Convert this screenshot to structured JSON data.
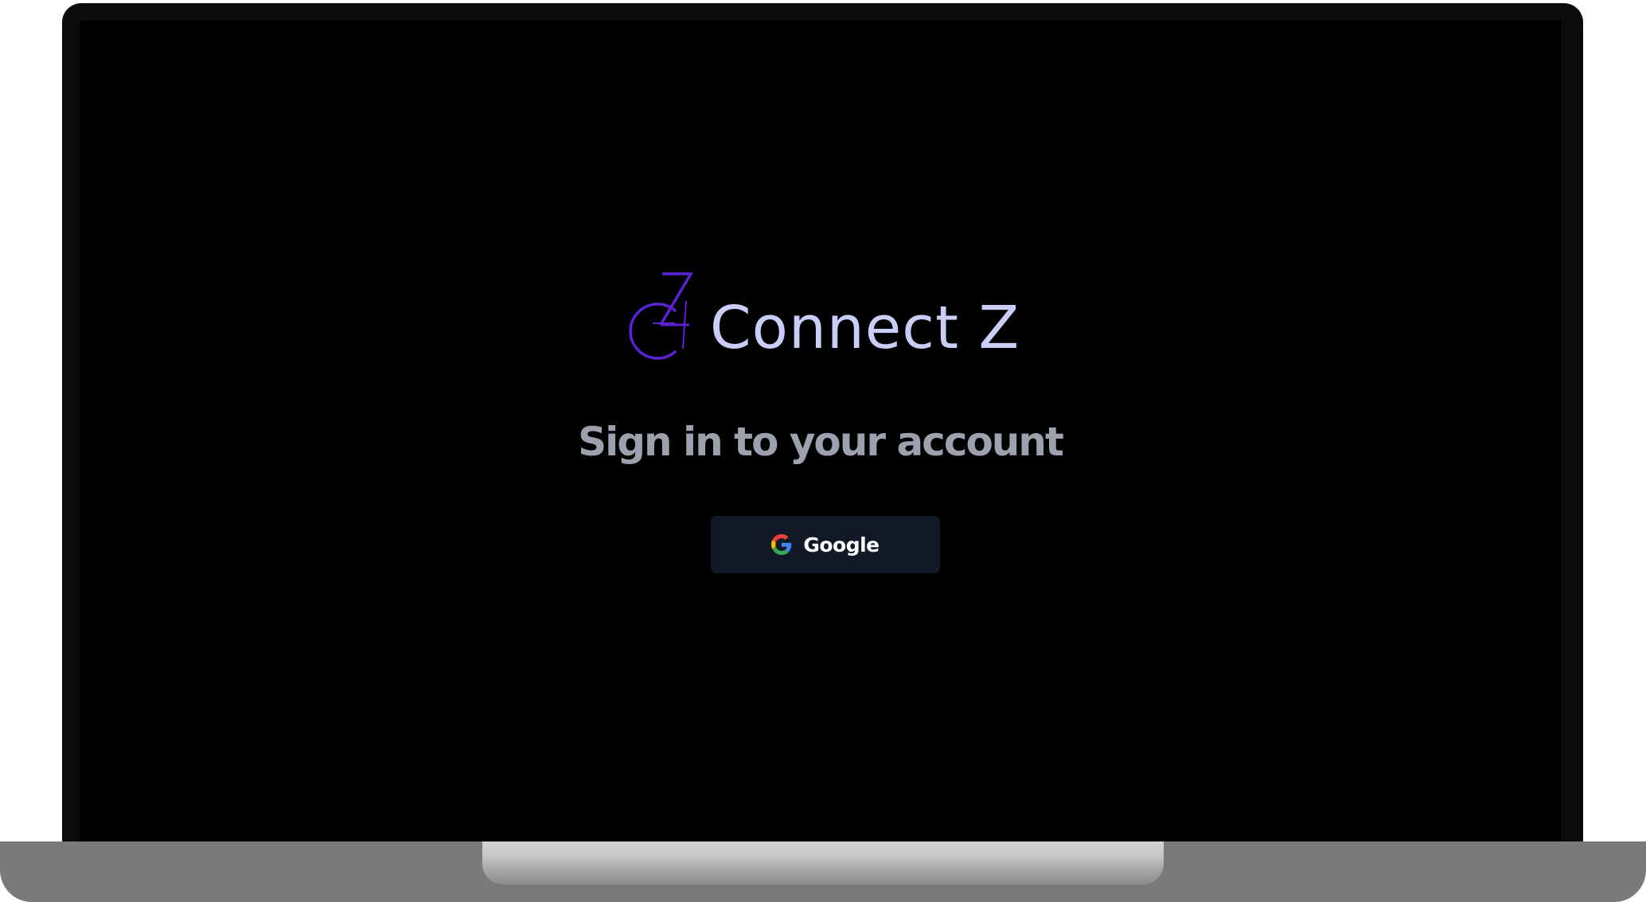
{
  "brand": {
    "name": "Connect Z",
    "logo_icon": "cz-monogram-icon",
    "accent_color": "#5b21d6",
    "text_color": "#c9cdf7"
  },
  "auth": {
    "heading": "Sign in to your account",
    "providers": [
      {
        "label": "Google",
        "icon": "google-icon"
      }
    ]
  },
  "colors": {
    "screen_background": "#000000",
    "button_background": "#111827",
    "heading_color": "#9ca1ad"
  }
}
